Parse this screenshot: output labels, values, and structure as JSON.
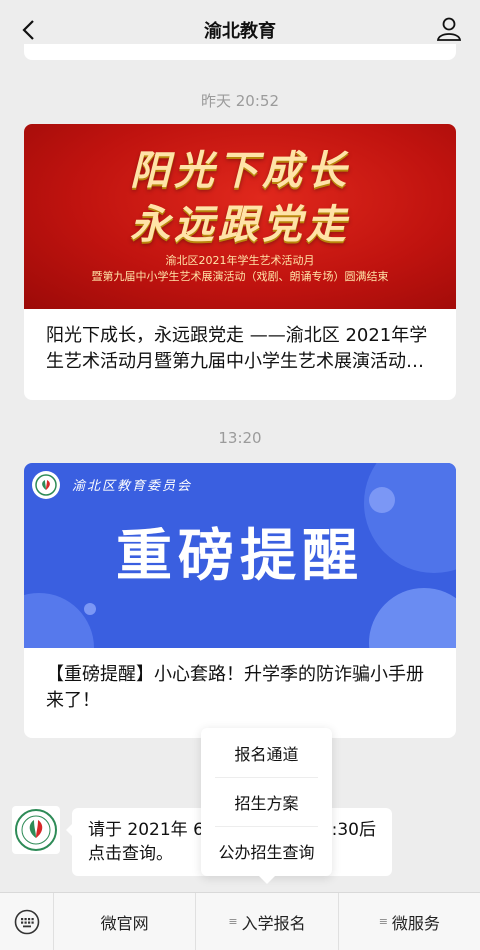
{
  "header": {
    "title": "渝北教育"
  },
  "timestamps": {
    "first": "昨天 20:52",
    "second": "13:20"
  },
  "article1": {
    "banner_line1": "阳光下成长",
    "banner_line2": "永远跟党走",
    "banner_sub1": "渝北区2021年学生艺术活动月",
    "banner_sub2": "暨第九届中小学生艺术展演活动（戏剧、朗诵专场）圆满结束",
    "caption": "阳光下成长，永远跟党走 ——渝北区 2021年学生艺术活动月暨第九届中小学生艺术展演活动（戏剧、朗诵专场）圆满结束"
  },
  "article2": {
    "banner_org": "渝北区教育委员会",
    "banner_big": "重磅提醒",
    "caption": "【重磅提醒】小心套路！升学季的防诈骗小手册来了！"
  },
  "message": {
    "text_before": "请于 2021年 6",
    "text_after": ":30后",
    "text_line2": "点击查询。"
  },
  "popup_menu": {
    "items": [
      "报名通道",
      "招生方案",
      "公办招生查询"
    ]
  },
  "bottom_menu": {
    "items": [
      "微官网",
      "入学报名",
      "微服务"
    ]
  },
  "colors": {
    "background": "#ededed",
    "red_banner": "#c0130f",
    "blue_banner": "#3a5fe0",
    "banner_gold": "#ffe3a8"
  }
}
